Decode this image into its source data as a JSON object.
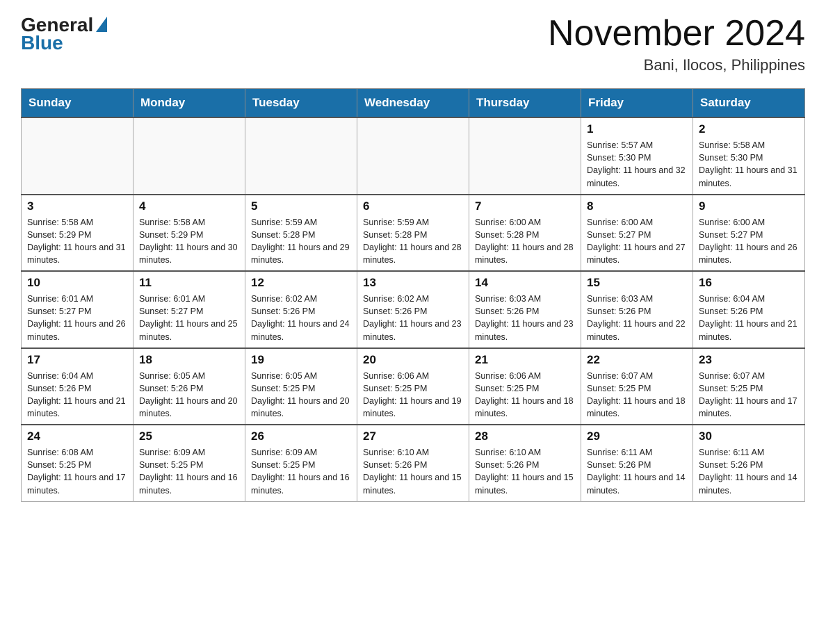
{
  "header": {
    "logo_general": "General",
    "logo_blue": "Blue",
    "month_title": "November 2024",
    "location": "Bani, Ilocos, Philippines"
  },
  "days_of_week": [
    "Sunday",
    "Monday",
    "Tuesday",
    "Wednesday",
    "Thursday",
    "Friday",
    "Saturday"
  ],
  "weeks": [
    [
      {
        "day": "",
        "info": ""
      },
      {
        "day": "",
        "info": ""
      },
      {
        "day": "",
        "info": ""
      },
      {
        "day": "",
        "info": ""
      },
      {
        "day": "",
        "info": ""
      },
      {
        "day": "1",
        "info": "Sunrise: 5:57 AM\nSunset: 5:30 PM\nDaylight: 11 hours and 32 minutes."
      },
      {
        "day": "2",
        "info": "Sunrise: 5:58 AM\nSunset: 5:30 PM\nDaylight: 11 hours and 31 minutes."
      }
    ],
    [
      {
        "day": "3",
        "info": "Sunrise: 5:58 AM\nSunset: 5:29 PM\nDaylight: 11 hours and 31 minutes."
      },
      {
        "day": "4",
        "info": "Sunrise: 5:58 AM\nSunset: 5:29 PM\nDaylight: 11 hours and 30 minutes."
      },
      {
        "day": "5",
        "info": "Sunrise: 5:59 AM\nSunset: 5:28 PM\nDaylight: 11 hours and 29 minutes."
      },
      {
        "day": "6",
        "info": "Sunrise: 5:59 AM\nSunset: 5:28 PM\nDaylight: 11 hours and 28 minutes."
      },
      {
        "day": "7",
        "info": "Sunrise: 6:00 AM\nSunset: 5:28 PM\nDaylight: 11 hours and 28 minutes."
      },
      {
        "day": "8",
        "info": "Sunrise: 6:00 AM\nSunset: 5:27 PM\nDaylight: 11 hours and 27 minutes."
      },
      {
        "day": "9",
        "info": "Sunrise: 6:00 AM\nSunset: 5:27 PM\nDaylight: 11 hours and 26 minutes."
      }
    ],
    [
      {
        "day": "10",
        "info": "Sunrise: 6:01 AM\nSunset: 5:27 PM\nDaylight: 11 hours and 26 minutes."
      },
      {
        "day": "11",
        "info": "Sunrise: 6:01 AM\nSunset: 5:27 PM\nDaylight: 11 hours and 25 minutes."
      },
      {
        "day": "12",
        "info": "Sunrise: 6:02 AM\nSunset: 5:26 PM\nDaylight: 11 hours and 24 minutes."
      },
      {
        "day": "13",
        "info": "Sunrise: 6:02 AM\nSunset: 5:26 PM\nDaylight: 11 hours and 23 minutes."
      },
      {
        "day": "14",
        "info": "Sunrise: 6:03 AM\nSunset: 5:26 PM\nDaylight: 11 hours and 23 minutes."
      },
      {
        "day": "15",
        "info": "Sunrise: 6:03 AM\nSunset: 5:26 PM\nDaylight: 11 hours and 22 minutes."
      },
      {
        "day": "16",
        "info": "Sunrise: 6:04 AM\nSunset: 5:26 PM\nDaylight: 11 hours and 21 minutes."
      }
    ],
    [
      {
        "day": "17",
        "info": "Sunrise: 6:04 AM\nSunset: 5:26 PM\nDaylight: 11 hours and 21 minutes."
      },
      {
        "day": "18",
        "info": "Sunrise: 6:05 AM\nSunset: 5:26 PM\nDaylight: 11 hours and 20 minutes."
      },
      {
        "day": "19",
        "info": "Sunrise: 6:05 AM\nSunset: 5:25 PM\nDaylight: 11 hours and 20 minutes."
      },
      {
        "day": "20",
        "info": "Sunrise: 6:06 AM\nSunset: 5:25 PM\nDaylight: 11 hours and 19 minutes."
      },
      {
        "day": "21",
        "info": "Sunrise: 6:06 AM\nSunset: 5:25 PM\nDaylight: 11 hours and 18 minutes."
      },
      {
        "day": "22",
        "info": "Sunrise: 6:07 AM\nSunset: 5:25 PM\nDaylight: 11 hours and 18 minutes."
      },
      {
        "day": "23",
        "info": "Sunrise: 6:07 AM\nSunset: 5:25 PM\nDaylight: 11 hours and 17 minutes."
      }
    ],
    [
      {
        "day": "24",
        "info": "Sunrise: 6:08 AM\nSunset: 5:25 PM\nDaylight: 11 hours and 17 minutes."
      },
      {
        "day": "25",
        "info": "Sunrise: 6:09 AM\nSunset: 5:25 PM\nDaylight: 11 hours and 16 minutes."
      },
      {
        "day": "26",
        "info": "Sunrise: 6:09 AM\nSunset: 5:25 PM\nDaylight: 11 hours and 16 minutes."
      },
      {
        "day": "27",
        "info": "Sunrise: 6:10 AM\nSunset: 5:26 PM\nDaylight: 11 hours and 15 minutes."
      },
      {
        "day": "28",
        "info": "Sunrise: 6:10 AM\nSunset: 5:26 PM\nDaylight: 11 hours and 15 minutes."
      },
      {
        "day": "29",
        "info": "Sunrise: 6:11 AM\nSunset: 5:26 PM\nDaylight: 11 hours and 14 minutes."
      },
      {
        "day": "30",
        "info": "Sunrise: 6:11 AM\nSunset: 5:26 PM\nDaylight: 11 hours and 14 minutes."
      }
    ]
  ]
}
